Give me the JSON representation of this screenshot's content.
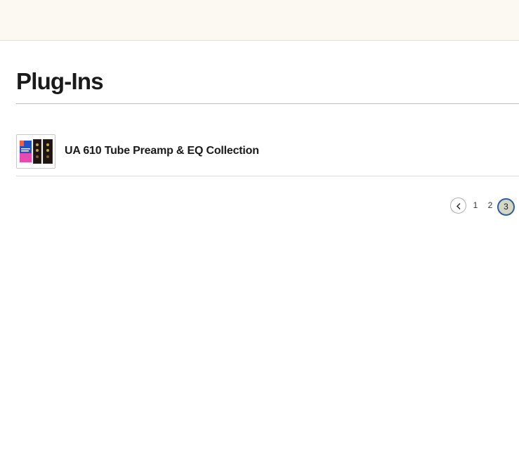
{
  "header": {
    "background_color": "#fcf9f3"
  },
  "main": {
    "title": "Plug-Ins",
    "products": [
      {
        "name": "UA 610 Tube Preamp & EQ Collection",
        "thumbnail_icon": "product-thumbnail"
      }
    ]
  },
  "pagination": {
    "prev_icon": "chevron-left-icon",
    "pages": [
      "1",
      "2"
    ],
    "current_page": "3",
    "current_color": "#d4d7c4",
    "current_border_color": "#2f5fa0"
  }
}
